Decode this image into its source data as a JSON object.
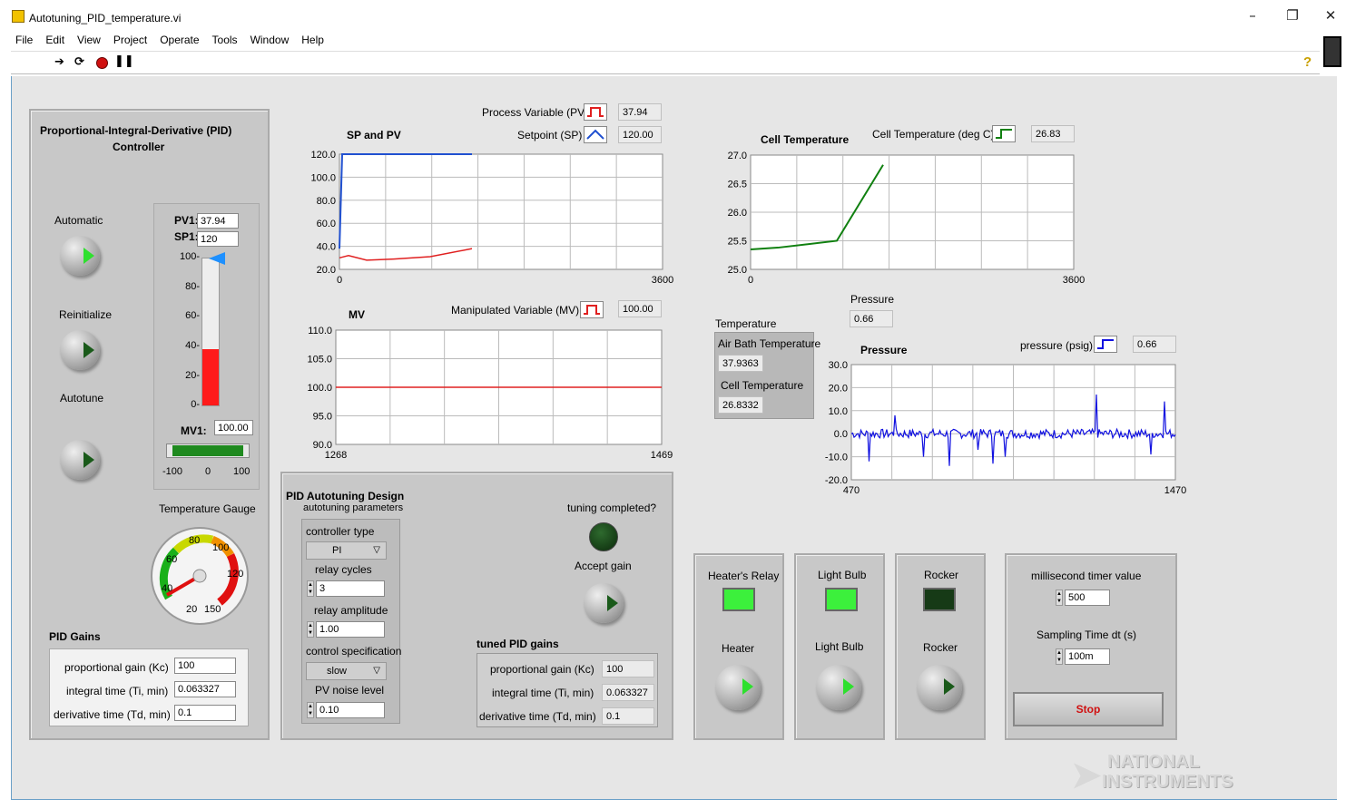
{
  "window": {
    "title": "Autotuning_PID_temperature.vi",
    "min": "–",
    "restore": "❐",
    "close": "✕"
  },
  "menu": [
    "File",
    "Edit",
    "View",
    "Project",
    "Operate",
    "Tools",
    "Window",
    "Help"
  ],
  "pid": {
    "title": "Proportional-Integral-Derivative (PID)",
    "title2": "Controller",
    "automatic": "Automatic",
    "reinitialize": "Reinitialize",
    "autotune": "Autotune",
    "pv1_label": "PV1:",
    "pv1": "37.94",
    "sp1_label": "SP1:",
    "sp1": "120",
    "tank_ticks": [
      "100-",
      "80-",
      "60-",
      "40-",
      "20-",
      "0-"
    ],
    "tank_level": 0.38,
    "mv1_label": "MV1:",
    "mv1": "100.00",
    "mv_ticks": [
      "-100",
      "0",
      "100"
    ],
    "gauge_title": "Temperature Gauge",
    "gauge_ticks": [
      "20",
      "40",
      "60",
      "80",
      "100",
      "120",
      "150"
    ],
    "gains_title": "PID Gains",
    "kc_label": "proportional gain (Kc)",
    "kc": "100",
    "ti_label": "integral time (Ti, min)",
    "ti": "0.063327",
    "td_label": "derivative time (Td, min)",
    "td": "0.1"
  },
  "sp_pv": {
    "title": "SP and PV",
    "pv_legend": "Process Variable (PV)",
    "pv_value": "37.94",
    "sp_legend": "Setpoint (SP)",
    "sp_value": "120.00",
    "yticks": [
      "120.0",
      "100.0",
      "80.0",
      "60.0",
      "40.0",
      "20.0"
    ],
    "xmin": "0",
    "xmax": "3600"
  },
  "mv": {
    "title": "MV",
    "legend": "Manipulated Variable (MV)",
    "value": "100.00",
    "yticks": [
      "110.0",
      "105.0",
      "100.0",
      "95.0",
      "90.0"
    ],
    "xmin": "1268",
    "xmax": "1469"
  },
  "cell": {
    "title": "Cell Temperature",
    "legend": "Cell Temperature (deg C)",
    "value": "26.83",
    "yticks": [
      "27.0",
      "26.5",
      "26.0",
      "25.5",
      "25.0"
    ],
    "xmin": "0",
    "xmax": "3600"
  },
  "pressure_ind": {
    "label": "Pressure",
    "value": "0.66"
  },
  "temperature": {
    "label": "Temperature",
    "air_label": "Air Bath Temperature",
    "air_value": "37.9363",
    "cell_label": "Cell Temperature",
    "cell_value": "26.8332"
  },
  "pressure": {
    "title": "Pressure",
    "legend": "pressure (psig)",
    "value": "0.66",
    "yticks": [
      "30.0",
      "20.0",
      "10.0",
      "0.0",
      "-10.0",
      "-20.0"
    ],
    "xmin": "470",
    "xmax": "1470"
  },
  "autotune": {
    "title": "PID Autotuning Design",
    "subtitle": "autotuning parameters",
    "ctype_label": "controller type",
    "ctype": "PI",
    "cycles_label": "relay cycles",
    "cycles": "3",
    "amp_label": "relay amplitude",
    "amp": "1.00",
    "spec_label": "control specification",
    "spec": "slow",
    "noise_label": "PV noise level",
    "noise": "0.10",
    "tuning_label": "tuning completed?",
    "accept_label": "Accept gain",
    "tuned_title": "tuned PID gains",
    "kc_label": "proportional gain (Kc)",
    "kc": "100",
    "ti_label": "integral time (Ti, min)",
    "ti": "0.063327",
    "td_label": "derivative time (Td, min)",
    "td": "0.1"
  },
  "relays": {
    "heater_relay": "Heater's Relay",
    "heater": "Heater",
    "bulb_label": "Light Bulb",
    "bulb": "Light Bulb",
    "rocker_label": "Rocker",
    "rocker": "Rocker"
  },
  "timer": {
    "ms_label": "millisecond timer value",
    "ms": "500",
    "dt_label": "Sampling Time dt (s)",
    "dt": "100m",
    "stop": "Stop"
  },
  "brand": {
    "line1": "NATIONAL",
    "line2": "INSTRUMENTS"
  },
  "colors": {
    "pv": "#e02020",
    "sp": "#2050d0",
    "cell": "#108010",
    "pressure": "#1010e0",
    "led_on": "#3cf03c",
    "led_off": "#1a4a1a"
  }
}
